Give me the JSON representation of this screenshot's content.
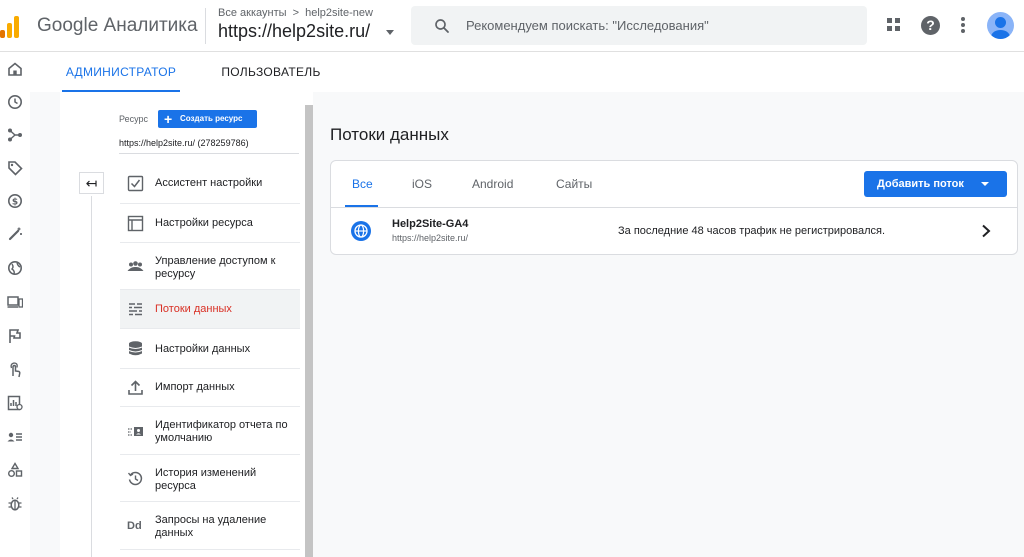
{
  "header": {
    "app_name": "Google Аналитика",
    "breadcrumb_all": "Все аккаунты",
    "breadcrumb_sep": ">",
    "breadcrumb_account": "help2site-new",
    "account_name": "https://help2site.ru/",
    "search_placeholder": "Рекомендуем поискать: \"Исследования\"",
    "help_symbol": "?"
  },
  "brand_colors": {
    "primary": "#1a73e8",
    "logo_orange": "#f9ab00",
    "logo_dark_orange": "#e37400",
    "active_item": "#d93025"
  },
  "admin_tabs": [
    {
      "label": "АДМИНИСТРАТОР",
      "active": true
    },
    {
      "label": "ПОЛЬЗОВАТЕЛЬ",
      "active": false
    }
  ],
  "rail_icons": [
    "home-icon",
    "clock-icon",
    "share-nodes-icon",
    "tag-icon",
    "dollar-icon",
    "wand-icon",
    "globe-icon",
    "devices-icon",
    "flag-icon",
    "touch-icon",
    "report-icon",
    "list-person-icon",
    "shapes-icon",
    "bug-icon"
  ],
  "left_panel": {
    "collapse_symbol": "↤",
    "resource_label": "Ресурс",
    "create_button": "Создать ресурс",
    "create_plus": "+",
    "resource_value": "https://help2site.ru/ (278259786)",
    "items": [
      {
        "label": "Ассистент настройки",
        "icon": "checklist-icon",
        "active": false
      },
      {
        "label": "Настройки ресурса",
        "icon": "window-icon",
        "active": false
      },
      {
        "label": "Управление доступом к ресурсу",
        "icon": "people-icon",
        "active": false
      },
      {
        "label": "Потоки данных",
        "icon": "streams-icon",
        "active": true
      },
      {
        "label": "Настройки данных",
        "icon": "database-icon",
        "active": false
      },
      {
        "label": "Импорт данных",
        "icon": "upload-icon",
        "active": false
      },
      {
        "label": "Идентификатор отчета по умолчанию",
        "icon": "id-card-icon",
        "active": false
      },
      {
        "label": "История изменений ресурса",
        "icon": "history-icon",
        "active": false
      },
      {
        "label": "Запросы на удаление данных",
        "icon": "dd-icon",
        "active": false,
        "icon_text": "Dd"
      }
    ]
  },
  "main": {
    "title": "Потоки данных",
    "tabs": [
      {
        "label": "Все",
        "active": true
      },
      {
        "label": "iOS",
        "active": false
      },
      {
        "label": "Android",
        "active": false
      },
      {
        "label": "Сайты",
        "active": false
      }
    ],
    "add_button": "Добавить поток",
    "streams": [
      {
        "name": "Help2Site-GA4",
        "url": "https://help2site.ru/",
        "status": "За последние 48 часов трафик не регистрировался."
      }
    ]
  }
}
